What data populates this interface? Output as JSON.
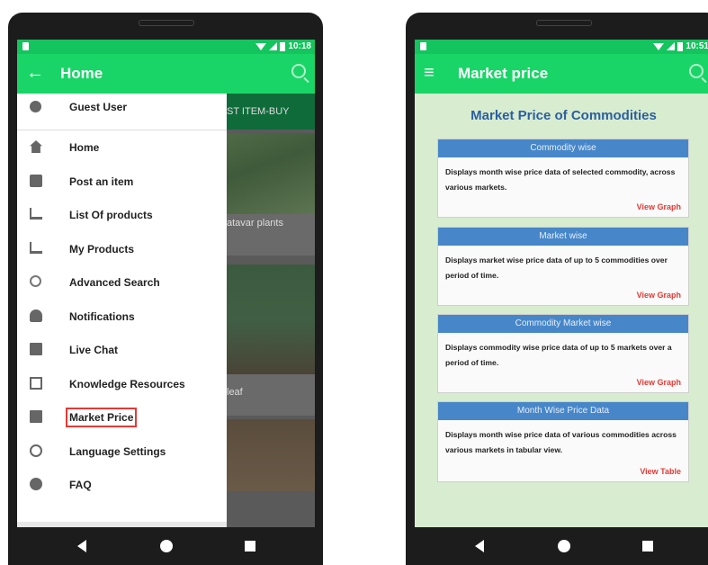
{
  "left_phone": {
    "status": {
      "time": "10:18"
    },
    "appbar": {
      "title": "Home",
      "nav_icon": "back-arrow-icon"
    },
    "background": {
      "tab_label": "ST ITEM-BUY",
      "card1_label": "atavar plants",
      "card2_label": "leaf"
    },
    "drawer": {
      "user": "Guest User",
      "items": [
        {
          "label": "Home",
          "icon": "home-icon"
        },
        {
          "label": "Post an item",
          "icon": "post-icon"
        },
        {
          "label": "List Of products",
          "icon": "cart-add-icon"
        },
        {
          "label": "My Products",
          "icon": "cart-icon"
        },
        {
          "label": "Advanced Search",
          "icon": "search-icon"
        },
        {
          "label": "Notifications",
          "icon": "bell-icon"
        },
        {
          "label": "Live Chat",
          "icon": "chat-icon"
        },
        {
          "label": "Knowledge Resources",
          "icon": "library-icon"
        },
        {
          "label": "Market Price",
          "icon": "chart-icon"
        },
        {
          "label": "Language Settings",
          "icon": "globe-icon"
        },
        {
          "label": "FAQ",
          "icon": "info-icon"
        }
      ]
    }
  },
  "right_phone": {
    "status": {
      "time": "10:51"
    },
    "appbar": {
      "title": "Market price",
      "nav_icon": "menu-icon"
    },
    "heading": "Market Price of Commodities",
    "cards": [
      {
        "title": "Commodity wise",
        "description": "Displays month wise price data of selected commodity, across various markets.",
        "action": "View Graph"
      },
      {
        "title": "Market wise",
        "description": "Displays market wise price data of up to 5 commodities over period of time.",
        "action": "View Graph"
      },
      {
        "title": "Commodity Market wise",
        "description": "Displays commodity wise price data of up to 5 markets over a period of time.",
        "action": "View Graph"
      },
      {
        "title": "Month Wise Price Data",
        "description": "Displays month wise price data of various commodities across various markets in tabular view.",
        "action": "View Table"
      }
    ]
  },
  "colors": {
    "appbar": "#19d567",
    "statusbar": "#14c45e",
    "accent_blue": "#4787c9",
    "action_red": "#e53935",
    "page_bg": "#d8ecd0"
  }
}
